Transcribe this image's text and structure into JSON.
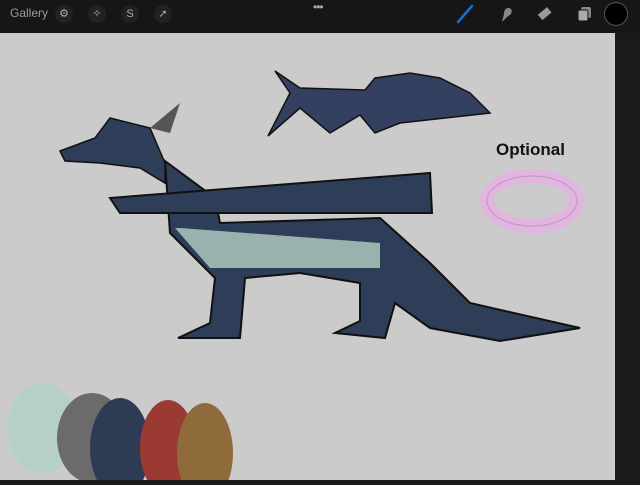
{
  "toolbar": {
    "gallery_label": "Gallery",
    "left_tools": [
      "wrench-icon",
      "magic-wand-icon",
      "selection-icon",
      "transform-arrow-icon"
    ],
    "more_label": "•••",
    "right_tools": [
      "brush-icon",
      "smudge-icon",
      "eraser-icon",
      "layers-icon"
    ],
    "active_tool": "brush",
    "current_color": "#000000",
    "accent": "#1a6cd8"
  },
  "canvas": {
    "annotation": "Optional",
    "palette": [
      "#b5d0c4",
      "#6b6b6b",
      "#2d3b55",
      "#9b3a33",
      "#8f6b3b"
    ]
  }
}
